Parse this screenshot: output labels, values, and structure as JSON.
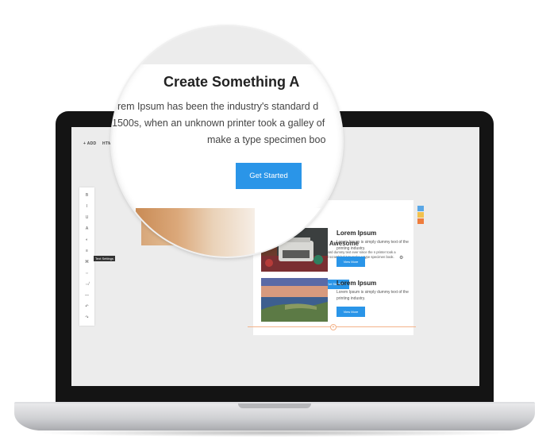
{
  "editor": {
    "topbar": {
      "add_label": "+ ADD",
      "html_label": "HTML"
    },
    "tooltip": "Text Settings",
    "tools": [
      {
        "icon": "bold-icon",
        "glyph": "B"
      },
      {
        "icon": "italic-icon",
        "glyph": "I"
      },
      {
        "icon": "underline-icon",
        "glyph": "U"
      },
      {
        "icon": "font-icon",
        "glyph": "A"
      },
      {
        "icon": "color-icon",
        "glyph": "◐"
      },
      {
        "icon": "align-icon",
        "glyph": "≡"
      },
      {
        "icon": "text-settings-icon",
        "glyph": "⌘"
      },
      {
        "icon": "link-icon",
        "glyph": "⇔"
      },
      {
        "icon": "unlink-icon",
        "glyph": "⇎"
      },
      {
        "icon": "divider-icon",
        "glyph": "—"
      },
      {
        "icon": "undo-icon",
        "glyph": "↶"
      },
      {
        "icon": "redo-icon",
        "glyph": "↷"
      }
    ]
  },
  "hero": {
    "title": "Create Something Awesome",
    "title_partial": "omething Awesome",
    "text_small": "e industry's standard dummy text ever since the n printer took a galley of type and scrambled it to make a type specimen book.",
    "button_label": "Get Started"
  },
  "partial_heading": "Lo",
  "cards": [
    {
      "title": "Lorem Ipsum",
      "text": "Lorem Ipsum is simply dummy text of the printing industry.",
      "button_label": "View More",
      "image": "typewriter-image"
    },
    {
      "title": "Lorem Ipsum",
      "text": "Lorem Ipsum is simply dummy text of the printing industry.",
      "button_label": "View More",
      "image": "coastal-landscape-image"
    }
  ],
  "magnifier": {
    "title": "Create Something A",
    "line1": "orem Ipsum has been the industry's standard d",
    "line2": "1500s, when an unknown printer took a galley of",
    "line3": "make a type specimen boo",
    "button_label": "Get Started"
  },
  "colors": {
    "accent": "#2a95e8",
    "badge_blue": "#5aa7e6",
    "badge_yellow": "#f2c14e",
    "badge_orange": "#ef7d3c"
  }
}
